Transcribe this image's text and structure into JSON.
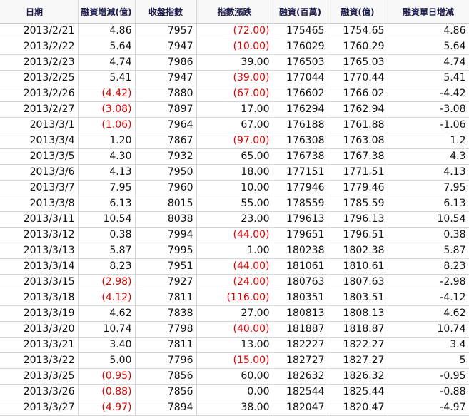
{
  "columns": [
    "日期",
    "融資增減(億)",
    "收盤指數",
    "指數漲跌",
    "融資(百萬)",
    "融資(億)",
    "融資單日增減"
  ],
  "rows": [
    [
      "2013/2/21",
      "4.86",
      "7957",
      "(72.00)",
      "175465",
      "1754.65",
      "4.86"
    ],
    [
      "2013/2/22",
      "5.64",
      "7947",
      "(10.00)",
      "176029",
      "1760.29",
      "5.64"
    ],
    [
      "2013/2/23",
      "4.74",
      "7986",
      "39.00",
      "176503",
      "1765.03",
      "4.74"
    ],
    [
      "2013/2/25",
      "5.41",
      "7947",
      "(39.00)",
      "177044",
      "1770.44",
      "5.41"
    ],
    [
      "2013/2/26",
      "(4.42)",
      "7880",
      "(67.00)",
      "176602",
      "1766.02",
      "-4.42"
    ],
    [
      "2013/2/27",
      "(3.08)",
      "7897",
      "17.00",
      "176294",
      "1762.94",
      "-3.08"
    ],
    [
      "2013/3/1",
      "(1.06)",
      "7964",
      "67.00",
      "176188",
      "1761.88",
      "-1.06"
    ],
    [
      "2013/3/4",
      "1.20",
      "7867",
      "(97.00)",
      "176308",
      "1763.08",
      "1.2"
    ],
    [
      "2013/3/5",
      "4.30",
      "7932",
      "65.00",
      "176738",
      "1767.38",
      "4.3"
    ],
    [
      "2013/3/6",
      "4.13",
      "7950",
      "18.00",
      "177151",
      "1771.51",
      "4.13"
    ],
    [
      "2013/3/7",
      "7.95",
      "7960",
      "10.00",
      "177946",
      "1779.46",
      "7.95"
    ],
    [
      "2013/3/8",
      "6.13",
      "8015",
      "55.00",
      "178559",
      "1785.59",
      "6.13"
    ],
    [
      "2013/3/11",
      "10.54",
      "8038",
      "23.00",
      "179613",
      "1796.13",
      "10.54"
    ],
    [
      "2013/3/12",
      "0.38",
      "7994",
      "(44.00)",
      "179651",
      "1796.51",
      "0.38"
    ],
    [
      "2013/3/13",
      "5.87",
      "7995",
      "1.00",
      "180238",
      "1802.38",
      "5.87"
    ],
    [
      "2013/3/14",
      "8.23",
      "7951",
      "(44.00)",
      "181061",
      "1810.61",
      "8.23"
    ],
    [
      "2013/3/15",
      "(2.98)",
      "7927",
      "(24.00)",
      "180763",
      "1807.63",
      "-2.98"
    ],
    [
      "2013/3/18",
      "(4.12)",
      "7811",
      "(116.00)",
      "180351",
      "1803.51",
      "-4.12"
    ],
    [
      "2013/3/19",
      "4.62",
      "7838",
      "27.00",
      "180813",
      "1808.13",
      "4.62"
    ],
    [
      "2013/3/20",
      "10.74",
      "7798",
      "(40.00)",
      "181887",
      "1818.87",
      "10.74"
    ],
    [
      "2013/3/21",
      "3.40",
      "7811",
      "13.00",
      "182227",
      "1822.27",
      "3.4"
    ],
    [
      "2013/3/22",
      "5.00",
      "7796",
      "(15.00)",
      "182727",
      "1827.27",
      "5"
    ],
    [
      "2013/3/25",
      "(0.95)",
      "7856",
      "60.00",
      "182632",
      "1826.32",
      "-0.95"
    ],
    [
      "2013/3/26",
      "(0.88)",
      "7856",
      "0.00",
      "182544",
      "1825.44",
      "-0.88"
    ],
    [
      "2013/3/27",
      "(4.97)",
      "7894",
      "38.00",
      "182047",
      "1820.47",
      "-4.97"
    ]
  ]
}
